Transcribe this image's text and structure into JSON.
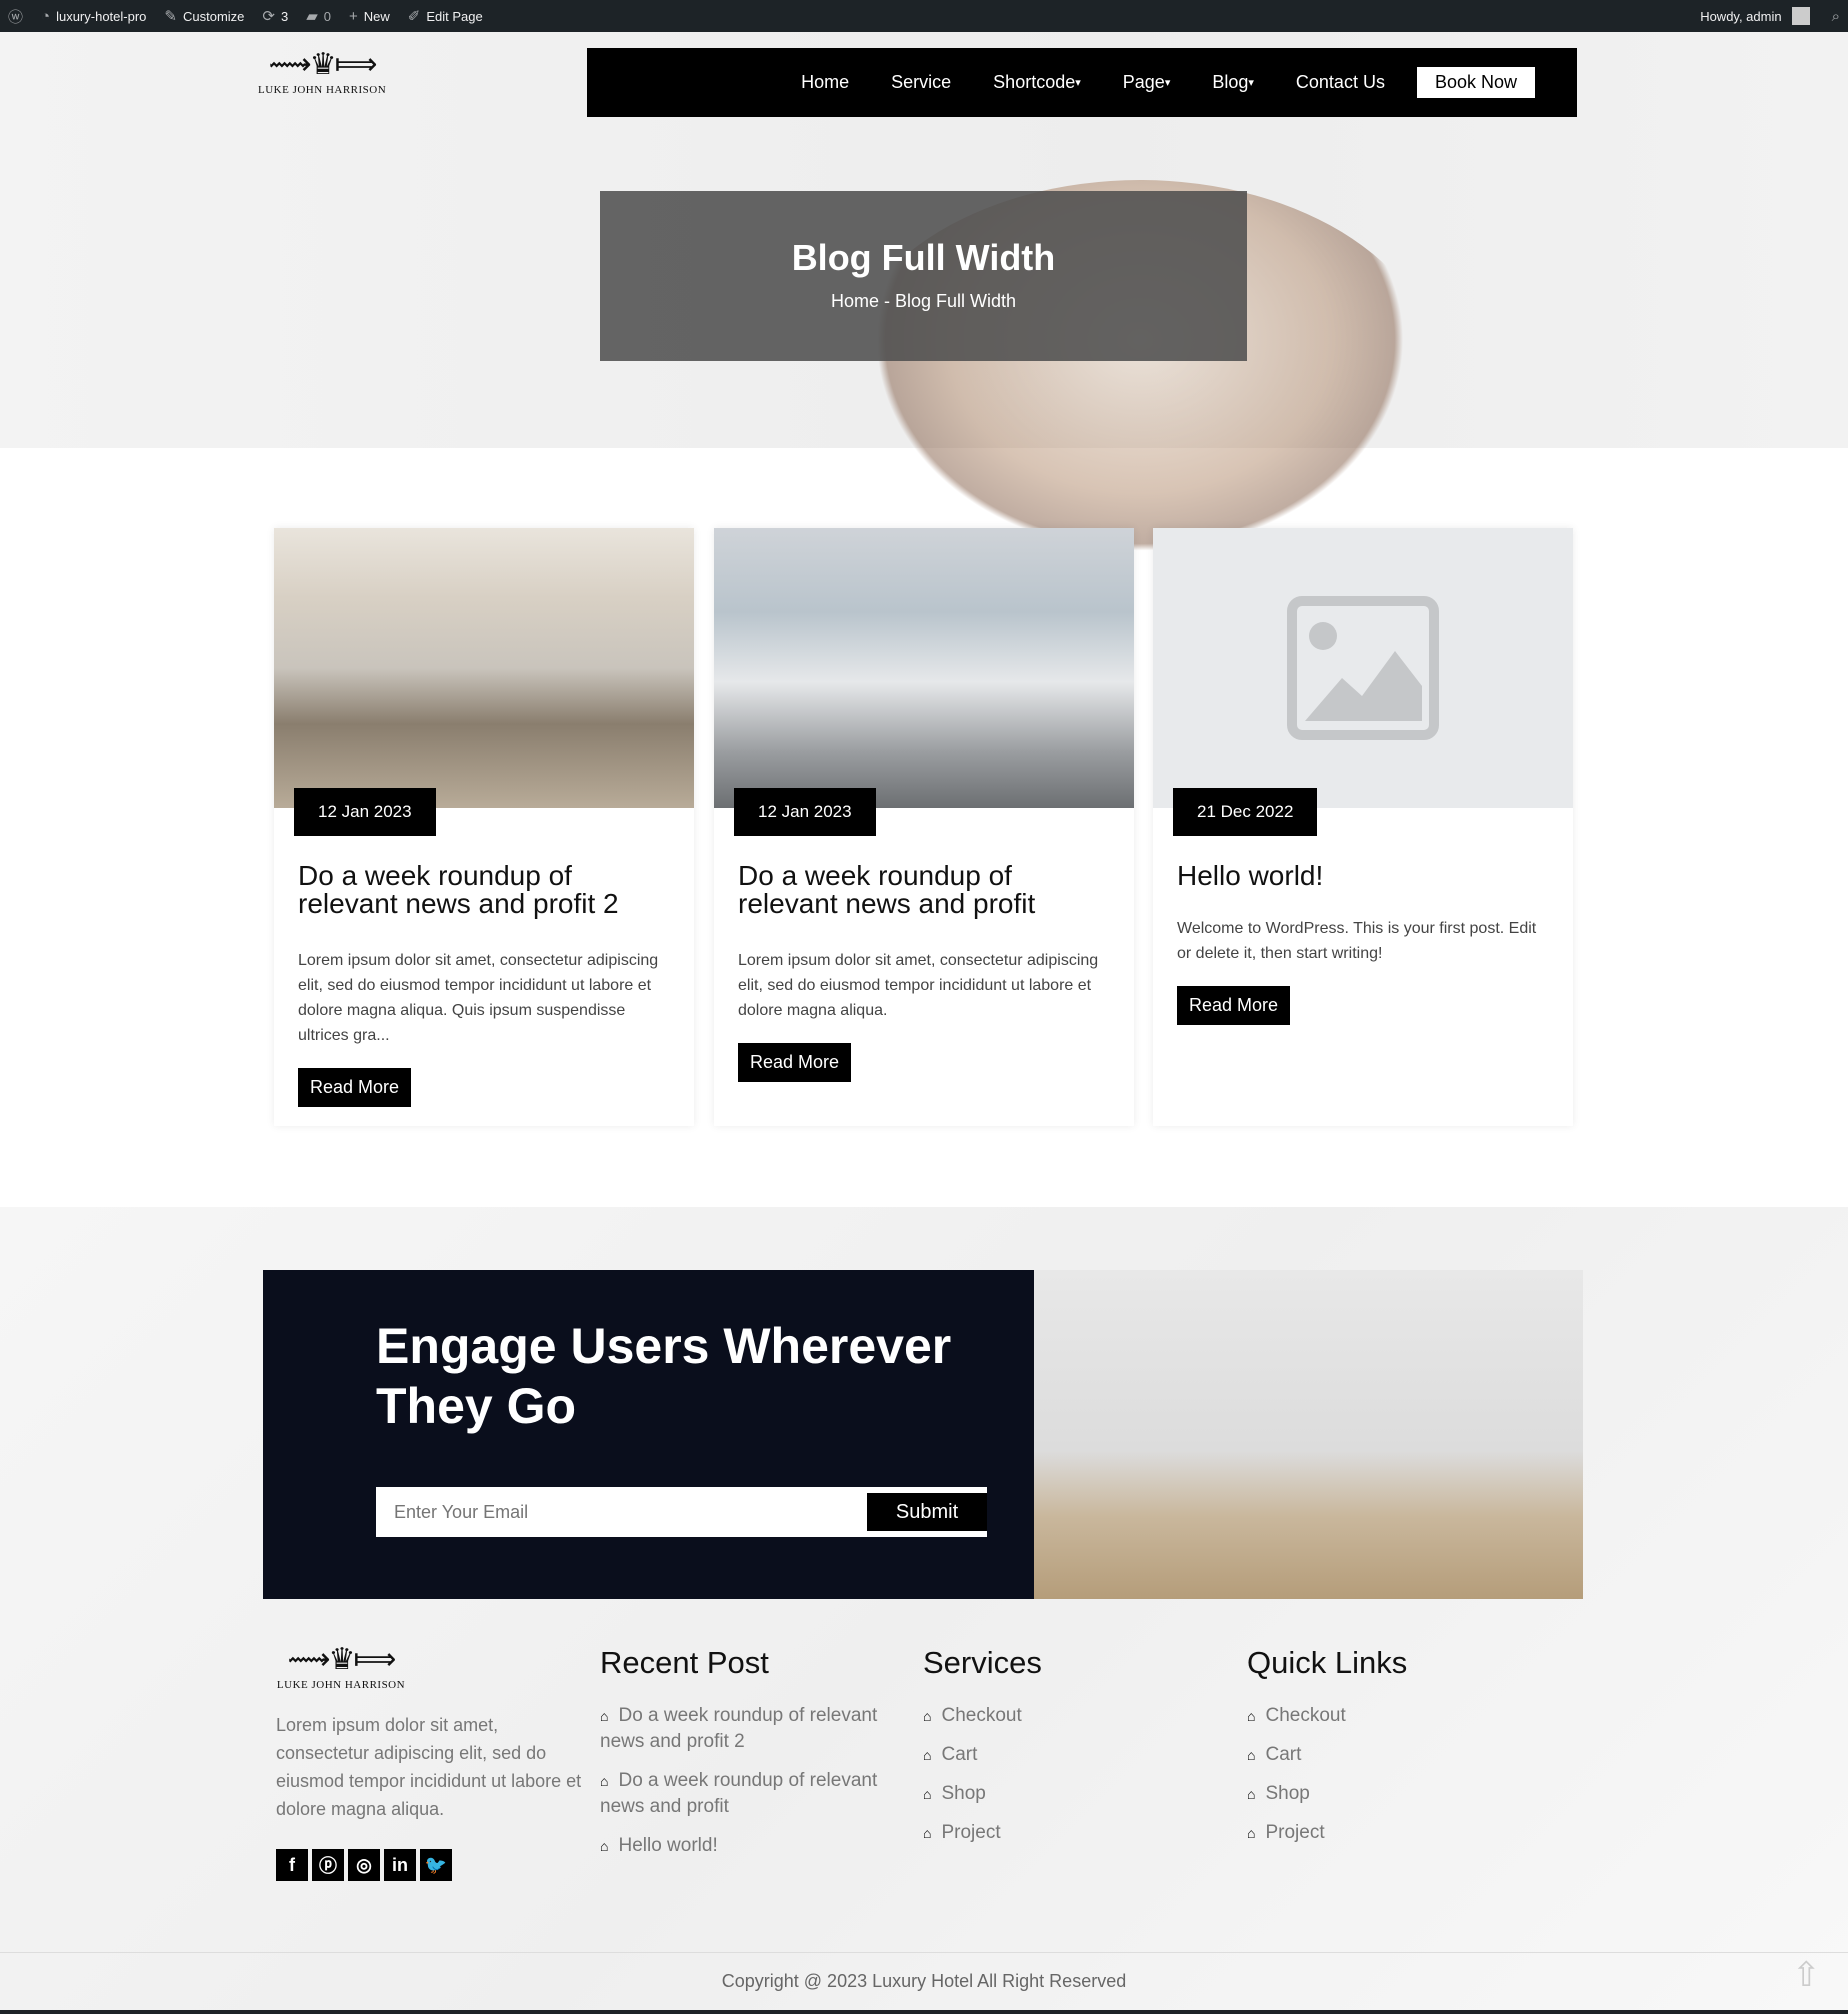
{
  "admin_bar": {
    "site": "luxury-hotel-pro",
    "customize": "Customize",
    "updates": "3",
    "comments": "0",
    "new": "New",
    "edit": "Edit Page",
    "howdy": "Howdy, admin"
  },
  "logo": {
    "name": "LUKE JOHN HARRISON"
  },
  "nav": {
    "items": [
      "Home",
      "Service",
      "Shortcode",
      "Page",
      "Blog",
      "Contact Us"
    ],
    "book": "Book Now"
  },
  "banner": {
    "title": "Blog Full Width",
    "crumb_home": "Home",
    "crumb_sep": "-",
    "crumb_current": "Blog Full Width"
  },
  "posts": [
    {
      "date": "12 Jan 2023",
      "title": "Do a week roundup of relevant news and profit 2",
      "excerpt": "Lorem ipsum dolor sit amet, consectetur adipiscing elit, sed do eiusmod tempor incididunt ut labore et dolore magna aliqua. Quis ipsum suspendisse ultrices gra...",
      "button": "Read More"
    },
    {
      "date": "12 Jan 2023",
      "title": "Do a week roundup of relevant news and profit",
      "excerpt": "Lorem ipsum dolor sit amet, consectetur adipiscing elit, sed do eiusmod tempor incididunt ut labore et dolore magna aliqua.",
      "button": "Read More"
    },
    {
      "date": "21 Dec 2022",
      "title": "Hello world!",
      "excerpt": "Welcome to WordPress. This is your first post. Edit or delete it, then start writing!",
      "button": "Read More"
    }
  ],
  "newsletter": {
    "title": "Engage Users Wherever They Go",
    "placeholder": "Enter Your Email",
    "submit": "Submit"
  },
  "footer": {
    "about": "Lorem ipsum dolor sit amet, consectetur adipiscing elit, sed do eiusmod tempor incididunt ut labore et dolore magna aliqua.",
    "social": [
      "facebook",
      "pinterest",
      "instagram",
      "linkedin",
      "twitter"
    ],
    "recent_title": "Recent Post",
    "recent": [
      "Do a week roundup of relevant news and profit 2",
      "Do a week roundup of relevant news and profit",
      "Hello world!"
    ],
    "services_title": "Services",
    "services": [
      "Checkout",
      "Cart",
      "Shop",
      "Project"
    ],
    "links_title": "Quick Links",
    "links": [
      "Checkout",
      "Cart",
      "Shop",
      "Project"
    ],
    "copyright": "Copyright @ 2023 Luxury Hotel All Right Reserved"
  }
}
